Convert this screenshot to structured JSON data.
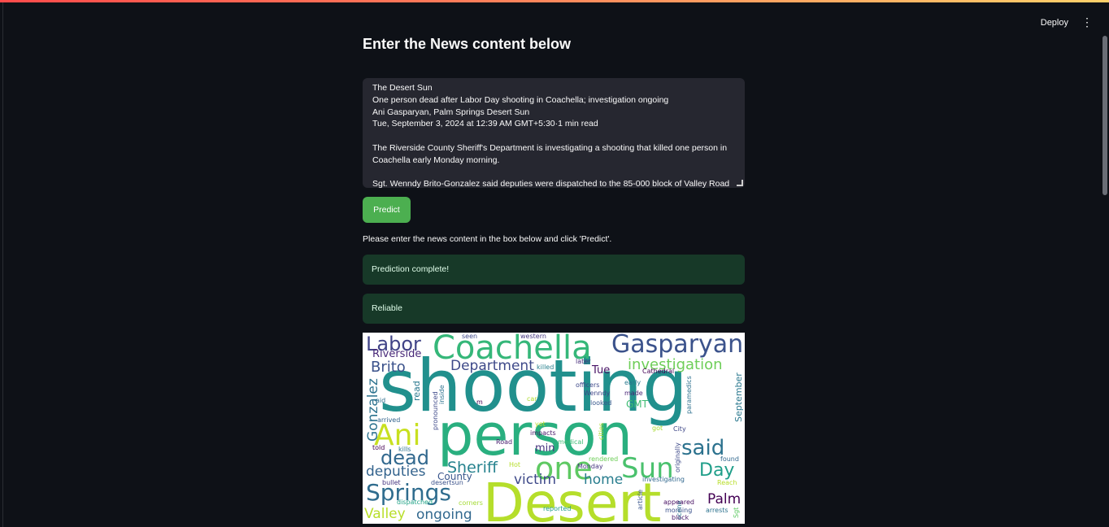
{
  "header": {
    "deploy_label": "Deploy",
    "menu_icon": "kebab-menu-icon"
  },
  "page": {
    "title": "Enter the News content below",
    "textarea_lines": [
      "The Desert Sun",
      "One person dead after Labor Day shooting in Coachella; investigation ongoing",
      "Ani Gasparyan, Palm Springs Desert Sun",
      "Tue, September 3, 2024 at 12:39 AM GMT+5:30·1 min read",
      "",
      "The Riverside County Sheriff's Department is investigating a shooting that killed one person in",
      "Coachella early Monday morning.",
      "",
      "Sgt. Wenndy Brito-Gonzalez said deputies were dispatched to the 85-000 block of Valley Road at"
    ],
    "predict_label": "Predict",
    "hint": "Please enter the news content in the box below and click 'Predict'.",
    "status_complete": "Prediction complete!",
    "result_label": "Reliable"
  },
  "wordcloud": {
    "words": [
      {
        "text": "shooting",
        "color": "#21908d"
      },
      {
        "text": "person",
        "color": "#29af7f"
      },
      {
        "text": "Desert",
        "color": "#b5de2b"
      },
      {
        "text": "Coachella",
        "color": "#35b779"
      },
      {
        "text": "Gasparyan",
        "color": "#3b528b"
      },
      {
        "text": "Labor",
        "color": "#414487"
      },
      {
        "text": "one",
        "color": "#5ec962"
      },
      {
        "text": "Sun",
        "color": "#4ac16d"
      },
      {
        "text": "Ani",
        "color": "#c8e020"
      },
      {
        "text": "said",
        "color": "#2c728e"
      },
      {
        "text": "dead",
        "color": "#31688e"
      },
      {
        "text": "Springs",
        "color": "#2f6c8e"
      },
      {
        "text": "investigation",
        "color": "#6ece58"
      },
      {
        "text": "Department",
        "color": "#3e4989"
      },
      {
        "text": "Brito",
        "color": "#3b528b"
      },
      {
        "text": "Riverside",
        "color": "#482878"
      },
      {
        "text": "Gonzalez",
        "color": "#2c728e"
      },
      {
        "text": "Sheriff",
        "color": "#26828e"
      },
      {
        "text": "Day",
        "color": "#1f9e89"
      },
      {
        "text": "Palm",
        "color": "#440154"
      },
      {
        "text": "victim",
        "color": "#3e4989"
      },
      {
        "text": "home",
        "color": "#287d8e"
      },
      {
        "text": "deputies",
        "color": "#33638d"
      },
      {
        "text": "ongoing",
        "color": "#31688e"
      },
      {
        "text": "Valley",
        "color": "#b8de29"
      },
      {
        "text": "September",
        "color": "#2a788e"
      },
      {
        "text": "read",
        "color": "#2a788e"
      },
      {
        "text": "min",
        "color": "#46337e"
      },
      {
        "text": "County",
        "color": "#39568c"
      },
      {
        "text": "Tue",
        "color": "#471365"
      },
      {
        "text": "GMT",
        "color": "#3fbc73"
      },
      {
        "text": "killed",
        "color": "#27808e"
      },
      {
        "text": "early",
        "color": "#2a788e"
      },
      {
        "text": "officers",
        "color": "#3e4989"
      },
      {
        "text": "Wenndy",
        "color": "#3f4788"
      },
      {
        "text": "looked",
        "color": "#38588c"
      },
      {
        "text": "made",
        "color": "#482576"
      },
      {
        "text": "Cathedral",
        "color": "#440154"
      },
      {
        "text": "later",
        "color": "#472c7a"
      },
      {
        "text": "western",
        "color": "#453781"
      },
      {
        "text": "seen",
        "color": "#3e4989"
      },
      {
        "text": "paramedics",
        "color": "#2d708e"
      },
      {
        "text": "arrived",
        "color": "#33638d"
      },
      {
        "text": "aid",
        "color": "#2e6e8e"
      },
      {
        "text": "pronounced",
        "color": "#3e4989"
      },
      {
        "text": "inside",
        "color": "#2c728e"
      },
      {
        "text": "impacts",
        "color": "#48186a"
      },
      {
        "text": "medical",
        "color": "#3dbc74"
      },
      {
        "text": "Road",
        "color": "#481d6f"
      },
      {
        "text": "told",
        "color": "#440154"
      },
      {
        "text": "kills",
        "color": "#2c728e"
      },
      {
        "text": "cities",
        "color": "#addc30"
      },
      {
        "text": "got",
        "color": "#a8db34"
      },
      {
        "text": "City",
        "color": "#3f4788"
      },
      {
        "text": "originally",
        "color": "#3e4a89"
      },
      {
        "text": "Monday",
        "color": "#463480"
      },
      {
        "text": "rendered",
        "color": "#6ece58"
      },
      {
        "text": "found",
        "color": "#31688e"
      },
      {
        "text": "Reach",
        "color": "#b8de29"
      },
      {
        "text": "investigating",
        "color": "#31688e"
      },
      {
        "text": "article",
        "color": "#39568c"
      },
      {
        "text": "scene",
        "color": "#2a788e"
      },
      {
        "text": "appeared",
        "color": "#471063"
      },
      {
        "text": "morning",
        "color": "#3b518b"
      },
      {
        "text": "block",
        "color": "#48186a"
      },
      {
        "text": "arrests",
        "color": "#2c728e"
      },
      {
        "text": "Sgt",
        "color": "#5ec962"
      },
      {
        "text": "bullet",
        "color": "#463480"
      },
      {
        "text": "desertsun",
        "color": "#3b528b"
      },
      {
        "text": "dispatched",
        "color": "#20a386"
      },
      {
        "text": "corners",
        "color": "#a5db36"
      },
      {
        "text": "reported",
        "color": "#1f9e89"
      },
      {
        "text": "Hot",
        "color": "#b5de2b"
      },
      {
        "text": "car",
        "color": "#addc30"
      },
      {
        "text": "m",
        "color": "#440154"
      },
      {
        "text": "yet",
        "color": "#b5de2b"
      }
    ]
  }
}
